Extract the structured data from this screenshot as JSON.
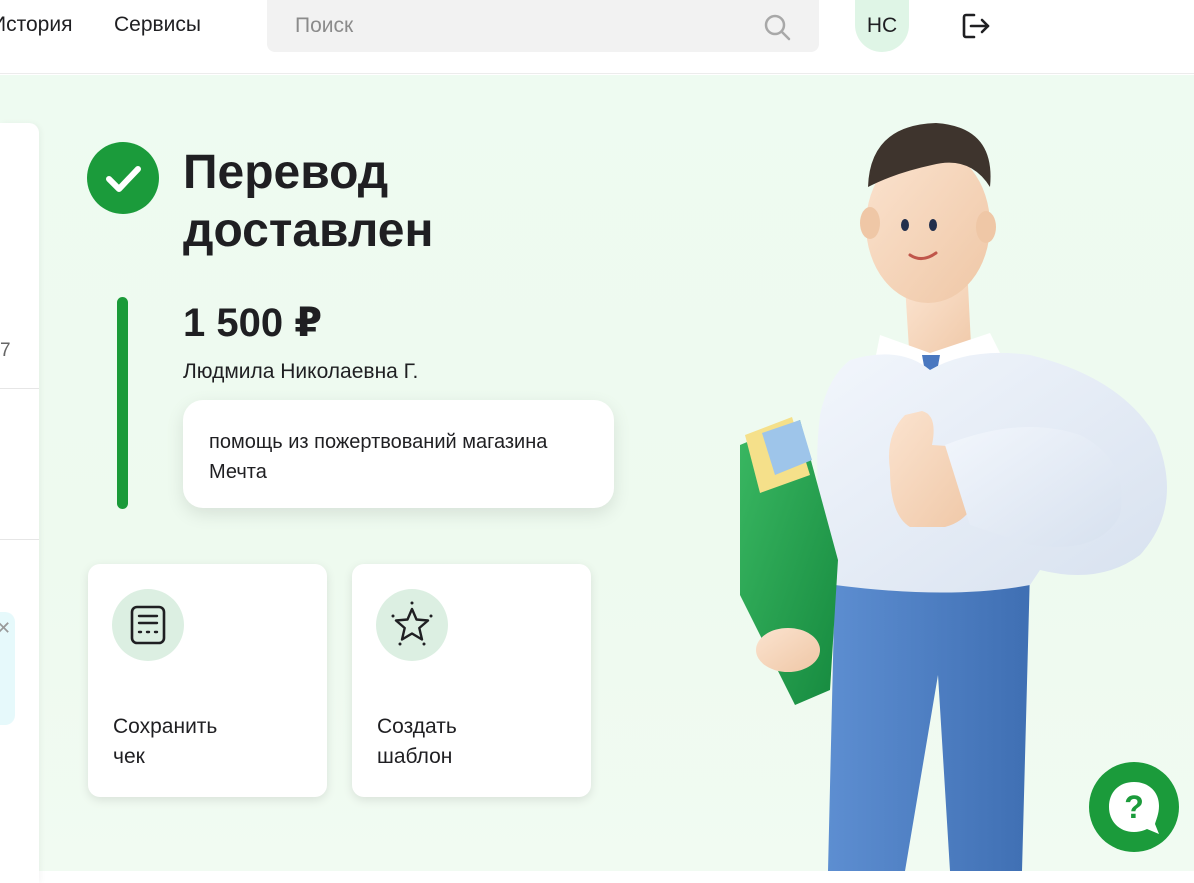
{
  "topbar": {
    "nav_history": "История",
    "nav_services": "Сервисы",
    "search_placeholder": "Поиск",
    "search_value": "",
    "avatar_initials": "НС"
  },
  "side_panel": {
    "number_fragment": "7"
  },
  "transfer": {
    "status_title": "Перевод\nдоставлен",
    "amount": "1 500 ₽",
    "recipient": "Людмила Николаевна Г.",
    "message": "помощь из пожертвований магазина Мечта"
  },
  "actions": [
    {
      "label": "Сохранить\nчек",
      "icon": "receipt-icon"
    },
    {
      "label": "Создать\nшаблон",
      "icon": "star-icon"
    }
  ],
  "help": {
    "label": "?"
  },
  "colors": {
    "brand_green": "#1b9b3b",
    "background_mint": "#eefbf1",
    "icon_circle": "#dcefe2",
    "avatar_bg": "#dff5e6"
  }
}
